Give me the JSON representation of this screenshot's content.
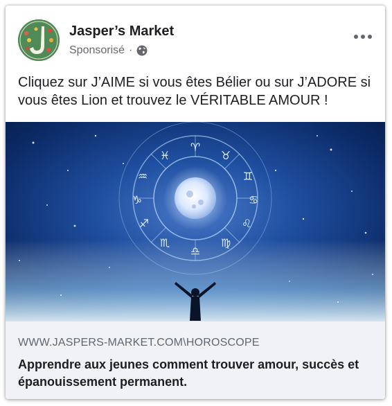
{
  "post": {
    "page_name": "Jasper’s Market",
    "sponsored_label": "Sponsorisé",
    "separator": "·",
    "audience_icon": "globe-icon",
    "more_icon": "more-options-icon",
    "text": "Cliquez sur J’AIME si vous êtes Bélier ou sur J’ADORE si vous êtes Lion et trouvez le VÉRITABLE AMOUR !",
    "image_subject": "zodiac-wheel-illustration",
    "link": {
      "domain": "WWW.JASPERS-MARKET.COM\\HOROSCOPE",
      "title": "Apprendre aux jeunes comment trouver amour, succès et épanouissement permanent."
    }
  },
  "colors": {
    "avatar_bg": "#4f8a57",
    "text_primary": "#1c1e21",
    "text_secondary": "#65676b",
    "link_bg": "#f0f2f5"
  }
}
